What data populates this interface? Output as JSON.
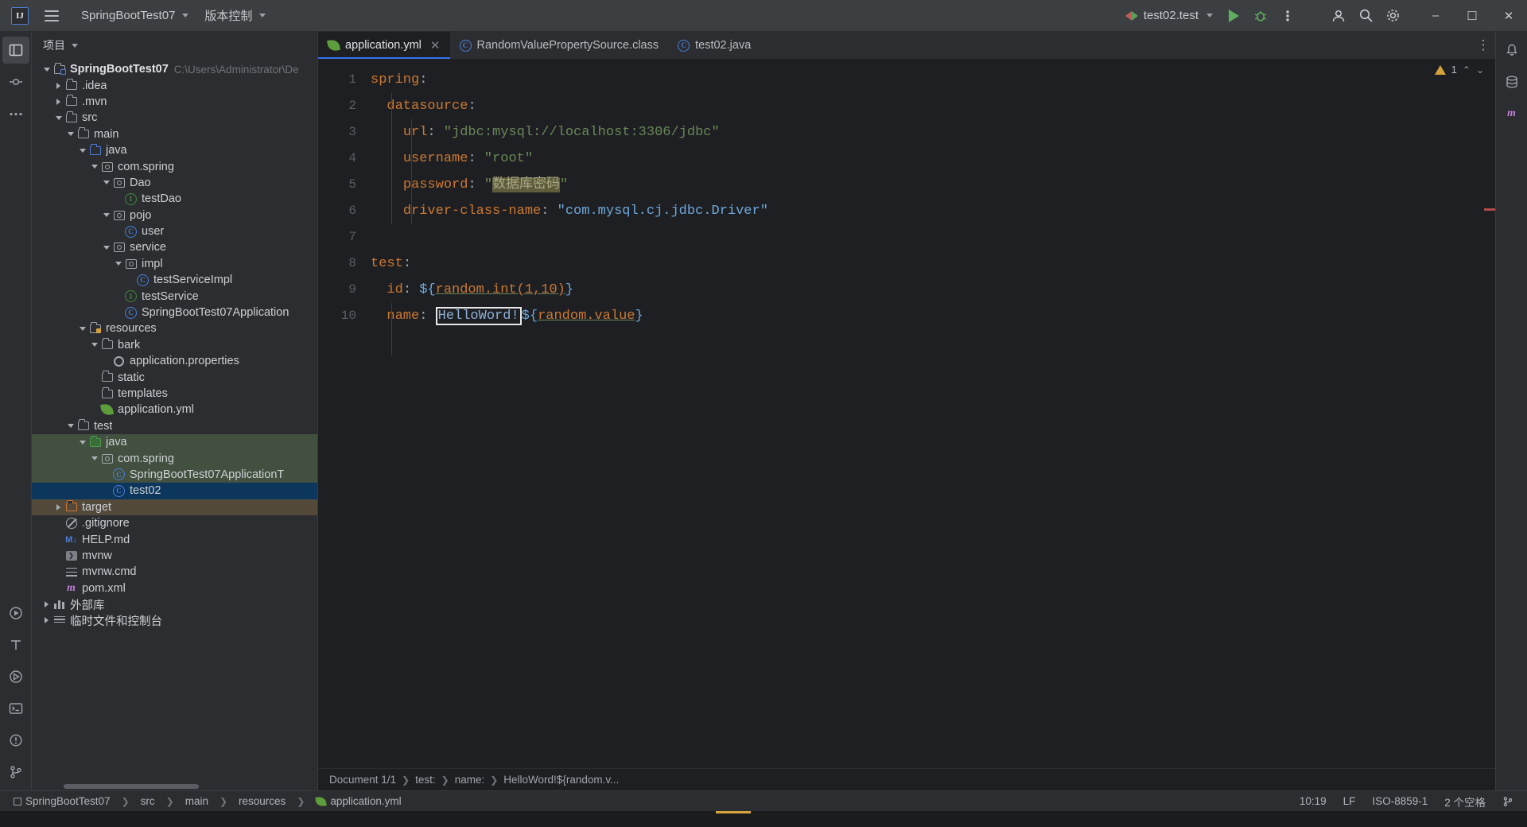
{
  "titlebar": {
    "logo": "IJ",
    "menu_icon": "hamburger-icon",
    "project_name": "SpringBootTest07",
    "vcs_label": "版本控制",
    "run_config": "test02.test",
    "run_icon": "run-icon",
    "debug_icon": "debug-icon",
    "more_icon": "more-actions-icon",
    "account_icon": "account-icon",
    "search_icon": "search-icon",
    "settings_icon": "settings-icon",
    "minimize": "–",
    "maximize": "☐",
    "close": "✕"
  },
  "project_panel": {
    "title": "项目",
    "tree": [
      {
        "depth": 0,
        "arrow": "down",
        "icon": "folder-module",
        "label": "SpringBootTest07",
        "bold": true,
        "path": "C:\\Users\\Administrator\\De"
      },
      {
        "depth": 1,
        "arrow": "right",
        "icon": "folder",
        "label": ".idea"
      },
      {
        "depth": 1,
        "arrow": "right",
        "icon": "folder",
        "label": ".mvn"
      },
      {
        "depth": 1,
        "arrow": "down",
        "icon": "folder",
        "label": "src"
      },
      {
        "depth": 2,
        "arrow": "down",
        "icon": "folder",
        "label": "main"
      },
      {
        "depth": 3,
        "arrow": "down",
        "icon": "folder-blue",
        "label": "java"
      },
      {
        "depth": 4,
        "arrow": "down",
        "icon": "package",
        "label": "com.spring"
      },
      {
        "depth": 5,
        "arrow": "down",
        "icon": "package",
        "label": "Dao"
      },
      {
        "depth": 6,
        "arrow": "none",
        "icon": "interface",
        "label": "testDao"
      },
      {
        "depth": 5,
        "arrow": "down",
        "icon": "package",
        "label": "pojo"
      },
      {
        "depth": 6,
        "arrow": "none",
        "icon": "class",
        "label": "user"
      },
      {
        "depth": 5,
        "arrow": "down",
        "icon": "package",
        "label": "service"
      },
      {
        "depth": 6,
        "arrow": "down",
        "icon": "package",
        "label": "impl"
      },
      {
        "depth": 7,
        "arrow": "none",
        "icon": "class",
        "label": "testServiceImpl"
      },
      {
        "depth": 6,
        "arrow": "none",
        "icon": "interface",
        "label": "testService"
      },
      {
        "depth": 6,
        "arrow": "none",
        "icon": "spring-class",
        "label": "SpringBootTest07Application"
      },
      {
        "depth": 3,
        "arrow": "down",
        "icon": "folder-res",
        "label": "resources"
      },
      {
        "depth": 4,
        "arrow": "down",
        "icon": "folder",
        "label": "bark"
      },
      {
        "depth": 5,
        "arrow": "none",
        "icon": "gear",
        "label": "application.properties"
      },
      {
        "depth": 4,
        "arrow": "none",
        "icon": "folder",
        "label": "static"
      },
      {
        "depth": 4,
        "arrow": "none",
        "icon": "folder",
        "label": "templates"
      },
      {
        "depth": 4,
        "arrow": "none",
        "icon": "spring-leaf",
        "label": "application.yml"
      },
      {
        "depth": 2,
        "arrow": "down",
        "icon": "folder",
        "label": "test"
      },
      {
        "depth": 3,
        "arrow": "down",
        "icon": "folder-testsrc",
        "label": "java",
        "hl": "src-green"
      },
      {
        "depth": 4,
        "arrow": "down",
        "icon": "package",
        "label": "com.spring",
        "hl": "src-green"
      },
      {
        "depth": 5,
        "arrow": "none",
        "icon": "class",
        "label": "SpringBootTest07ApplicationT",
        "hl": "src-green"
      },
      {
        "depth": 5,
        "arrow": "none",
        "icon": "class",
        "label": "test02",
        "hl": "sel-dark"
      },
      {
        "depth": 1,
        "arrow": "right",
        "icon": "folder-orange",
        "label": "target",
        "hl": "tgt-brown"
      },
      {
        "depth": 1,
        "arrow": "none",
        "icon": "gitignore",
        "label": ".gitignore"
      },
      {
        "depth": 1,
        "arrow": "none",
        "icon": "markdown",
        "label": "HELP.md"
      },
      {
        "depth": 1,
        "arrow": "none",
        "icon": "batch",
        "label": "mvnw"
      },
      {
        "depth": 1,
        "arrow": "none",
        "icon": "lines",
        "label": "mvnw.cmd"
      },
      {
        "depth": 1,
        "arrow": "none",
        "icon": "maven",
        "label": "pom.xml"
      },
      {
        "depth": 0,
        "arrow": "right",
        "icon": "library",
        "label": "外部库"
      },
      {
        "depth": 0,
        "arrow": "right",
        "icon": "console",
        "label": "临时文件和控制台"
      }
    ]
  },
  "editor": {
    "tabs": [
      {
        "label": "application.yml",
        "icon": "spring-leaf-icon",
        "active": true,
        "closable": true
      },
      {
        "label": "RandomValuePropertySource.class",
        "icon": "class-icon",
        "active": false,
        "closable": false
      },
      {
        "label": "test02.java",
        "icon": "class-icon",
        "active": false,
        "closable": false
      }
    ],
    "more_icon": "tab-options-icon",
    "inspection": {
      "count": "1",
      "icon": "warning-icon",
      "up": "⌃",
      "down": "⌄"
    },
    "lines": [
      "1",
      "2",
      "3",
      "4",
      "5",
      "6",
      "7",
      "8",
      "9",
      "10"
    ],
    "code": {
      "l1_key": "spring",
      "l1_colon": ":",
      "l2_key": "datasource",
      "l2_colon": ":",
      "l3_key": "url",
      "l3_colon": ":",
      "l3_val": "\"jdbc:mysql://localhost:3306/jdbc\"",
      "l4_key": "username",
      "l4_colon": ":",
      "l4_val": "\"root\"",
      "l5_key": "password",
      "l5_colon": ":",
      "l5_q1": "\"",
      "l5_hl": "数据库密码",
      "l5_q2": "\"",
      "l6_key": "driver-class-name",
      "l6_colon": ":",
      "l6_val": "\"com.mysql.cj.jdbc.Driver\"",
      "l7_val": "",
      "l8_key": "test",
      "l8_colon": ":",
      "l9_key": "id",
      "l9_colon": ":",
      "l9_dollar": "${",
      "l9_ph": "random.int(1,10)",
      "l9_close": "}",
      "l10_key": "name",
      "l10_colon": ":",
      "l10_sel": "HelloWord!",
      "l10_dollar": "${",
      "l10_ph": "random.value",
      "l10_close": "}"
    },
    "breadcrumb": [
      "Document 1/1",
      "test:",
      "name:",
      "HelloWord!${random.v..."
    ]
  },
  "statusbar": {
    "project": "SpringBootTest07",
    "crumbs": [
      "src",
      "main",
      "resources"
    ],
    "file": "application.yml",
    "file_icon": "spring-leaf-icon",
    "caret": "10:19",
    "line_sep": "LF",
    "encoding": "ISO-8859-1",
    "indent": "2 个空格"
  }
}
